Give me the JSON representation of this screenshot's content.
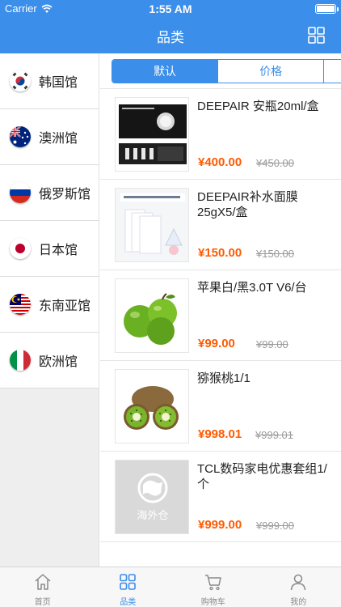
{
  "status_bar": {
    "carrier": "Carrier",
    "time": "1:55 AM"
  },
  "nav": {
    "title": "品类",
    "grid_icon": "grid-icon"
  },
  "sidebar": {
    "items": [
      {
        "label": "韩国馆",
        "flag": "korea-flag-icon"
      },
      {
        "label": "澳洲馆",
        "flag": "australia-flag-icon"
      },
      {
        "label": "俄罗斯馆",
        "flag": "russia-flag-icon"
      },
      {
        "label": "日本馆",
        "flag": "japan-flag-icon"
      },
      {
        "label": "东南亚馆",
        "flag": "malaysia-flag-icon"
      },
      {
        "label": "欧洲馆",
        "flag": "italy-flag-icon"
      }
    ]
  },
  "sort": {
    "options": [
      "默认",
      "价格"
    ],
    "selected": "默认"
  },
  "products": [
    {
      "name": "DEEPAIR 安瓶20ml/盒",
      "price": "¥400.00",
      "old_price": "¥450.00",
      "image": "ampoule-box-image"
    },
    {
      "name": "DEEPAIR补水面膜25gX5/盒",
      "price": "¥150.00",
      "old_price": "¥150.00",
      "image": "face-mask-image"
    },
    {
      "name": "苹果白/黑3.0T V6/台",
      "price": "¥99.00",
      "old_price": "¥99.00",
      "image": "green-apples-image"
    },
    {
      "name": "猕猴桃1/1",
      "price": "¥998.01",
      "old_price": "¥999.01",
      "image": "kiwi-image"
    },
    {
      "name": "TCL数码家电优惠套组1/个",
      "price": "¥999.00",
      "old_price": "¥999.00",
      "image": "placeholder-logo-image",
      "placeholder_text": "海外仓"
    }
  ],
  "tabbar": {
    "tabs": [
      {
        "label": "首页",
        "icon": "home-icon"
      },
      {
        "label": "品类",
        "icon": "category-icon",
        "active": true
      },
      {
        "label": "购物车",
        "icon": "cart-icon"
      },
      {
        "label": "我的",
        "icon": "profile-icon"
      }
    ]
  },
  "colors": {
    "accent": "#3b8ee9",
    "price": "#ff5a00",
    "old_price": "#9a9a9a"
  }
}
